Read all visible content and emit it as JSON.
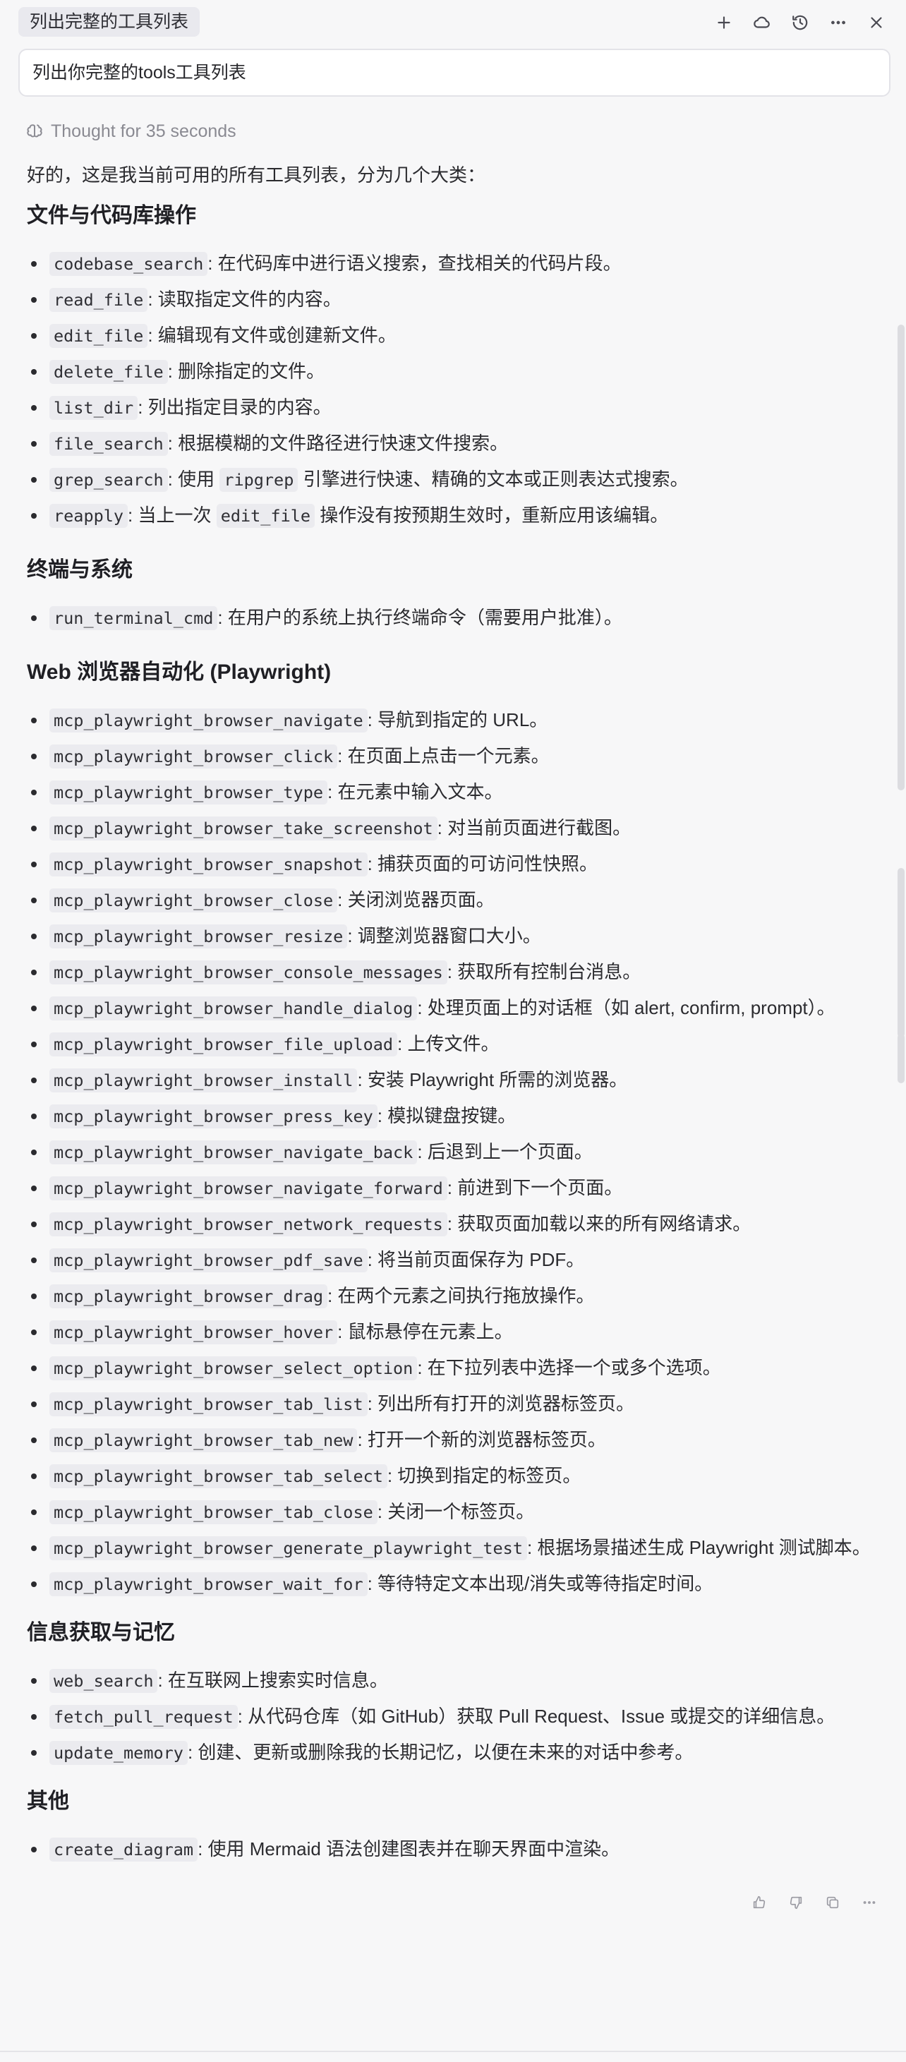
{
  "tab": {
    "title": "列出完整的工具列表"
  },
  "toolbar": {
    "icons": [
      "plus-icon",
      "cloud-icon",
      "history-icon",
      "more-icon",
      "close-icon"
    ]
  },
  "prompt": {
    "text": "列出你完整的tools工具列表"
  },
  "thought": {
    "label": "Thought for 35 seconds"
  },
  "response": {
    "intro": "好的，这是我当前可用的所有工具列表，分为几个大类：",
    "sections": [
      {
        "title": "文件与代码库操作",
        "items": [
          {
            "code": "codebase_search",
            "desc": ": 在代码库中进行语义搜索，查找相关的代码片段。"
          },
          {
            "code": "read_file",
            "desc": ": 读取指定文件的内容。"
          },
          {
            "code": "edit_file",
            "desc": ": 编辑现有文件或创建新文件。"
          },
          {
            "code": "delete_file",
            "desc": ": 删除指定的文件。"
          },
          {
            "code": "list_dir",
            "desc": ": 列出指定目录的内容。"
          },
          {
            "code": "file_search",
            "desc": ": 根据模糊的文件路径进行快速文件搜索。"
          },
          {
            "code": "grep_search",
            "desc": ": 使用 ",
            "code2": "ripgrep",
            "desc2": " 引擎进行快速、精确的文本或正则表达式搜索。"
          },
          {
            "code": "reapply",
            "desc": ": 当上一次 ",
            "code2": "edit_file",
            "desc2": " 操作没有按预期生效时，重新应用该编辑。"
          }
        ]
      },
      {
        "title": "终端与系统",
        "items": [
          {
            "code": "run_terminal_cmd",
            "desc": ": 在用户的系统上执行终端命令（需要用户批准）。"
          }
        ]
      },
      {
        "title": "Web 浏览器自动化 (Playwright)",
        "items": [
          {
            "code": "mcp_playwright_browser_navigate",
            "desc": ": 导航到指定的 URL。"
          },
          {
            "code": "mcp_playwright_browser_click",
            "desc": ": 在页面上点击一个元素。"
          },
          {
            "code": "mcp_playwright_browser_type",
            "desc": ": 在元素中输入文本。"
          },
          {
            "code": "mcp_playwright_browser_take_screenshot",
            "desc": ": 对当前页面进行截图。"
          },
          {
            "code": "mcp_playwright_browser_snapshot",
            "desc": ": 捕获页面的可访问性快照。"
          },
          {
            "code": "mcp_playwright_browser_close",
            "desc": ": 关闭浏览器页面。"
          },
          {
            "code": "mcp_playwright_browser_resize",
            "desc": ": 调整浏览器窗口大小。"
          },
          {
            "code": "mcp_playwright_browser_console_messages",
            "desc": ": 获取所有控制台消息。"
          },
          {
            "code": "mcp_playwright_browser_handle_dialog",
            "desc": ": 处理页面上的对话框（如 alert, confirm, prompt）。"
          },
          {
            "code": "mcp_playwright_browser_file_upload",
            "desc": ": 上传文件。"
          },
          {
            "code": "mcp_playwright_browser_install",
            "desc": ": 安装 Playwright 所需的浏览器。"
          },
          {
            "code": "mcp_playwright_browser_press_key",
            "desc": ": 模拟键盘按键。"
          },
          {
            "code": "mcp_playwright_browser_navigate_back",
            "desc": ": 后退到上一个页面。"
          },
          {
            "code": "mcp_playwright_browser_navigate_forward",
            "desc": ": 前进到下一个页面。"
          },
          {
            "code": "mcp_playwright_browser_network_requests",
            "desc": ": 获取页面加载以来的所有网络请求。"
          },
          {
            "code": "mcp_playwright_browser_pdf_save",
            "desc": ": 将当前页面保存为 PDF。"
          },
          {
            "code": "mcp_playwright_browser_drag",
            "desc": ": 在两个元素之间执行拖放操作。"
          },
          {
            "code": "mcp_playwright_browser_hover",
            "desc": ": 鼠标悬停在元素上。"
          },
          {
            "code": "mcp_playwright_browser_select_option",
            "desc": ": 在下拉列表中选择一个或多个选项。"
          },
          {
            "code": "mcp_playwright_browser_tab_list",
            "desc": ": 列出所有打开的浏览器标签页。"
          },
          {
            "code": "mcp_playwright_browser_tab_new",
            "desc": ": 打开一个新的浏览器标签页。"
          },
          {
            "code": "mcp_playwright_browser_tab_select",
            "desc": ": 切换到指定的标签页。"
          },
          {
            "code": "mcp_playwright_browser_tab_close",
            "desc": ": 关闭一个标签页。"
          },
          {
            "code": "mcp_playwright_browser_generate_playwright_test",
            "desc": ": 根据场景描述生成 Playwright 测试脚本。"
          },
          {
            "code": "mcp_playwright_browser_wait_for",
            "desc": ": 等待特定文本出现/消失或等待指定时间。"
          }
        ]
      },
      {
        "title": "信息获取与记忆",
        "items": [
          {
            "code": "web_search",
            "desc": ": 在互联网上搜索实时信息。"
          },
          {
            "code": "fetch_pull_request",
            "desc": ": 从代码仓库（如 GitHub）获取 Pull Request、Issue 或提交的详细信息。"
          },
          {
            "code": "update_memory",
            "desc": ": 创建、更新或删除我的长期记忆，以便在未来的对话中参考。"
          }
        ]
      },
      {
        "title": "其他",
        "items": [
          {
            "code": "create_diagram",
            "desc": ": 使用 Mermaid 语法创建图表并在聊天界面中渲染。"
          }
        ]
      }
    ]
  },
  "message_actions": [
    "thumbs-up-icon",
    "thumbs-down-icon",
    "copy-icon",
    "more-icon"
  ]
}
